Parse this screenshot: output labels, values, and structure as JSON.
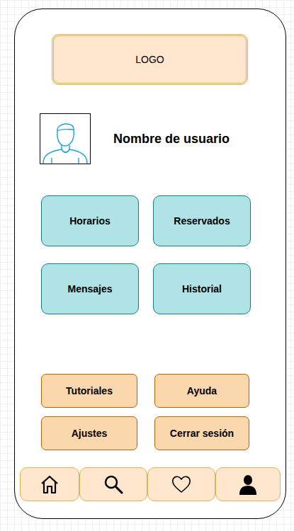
{
  "logo": "LOGO",
  "user": {
    "name": "Nombre de usuario"
  },
  "main_buttons": [
    "Horarios",
    "Reservados",
    "Mensajes",
    "Historial"
  ],
  "secondary_buttons": [
    "Tutoriales",
    "Ayuda",
    "Ajustes",
    "Cerrar sesión"
  ]
}
